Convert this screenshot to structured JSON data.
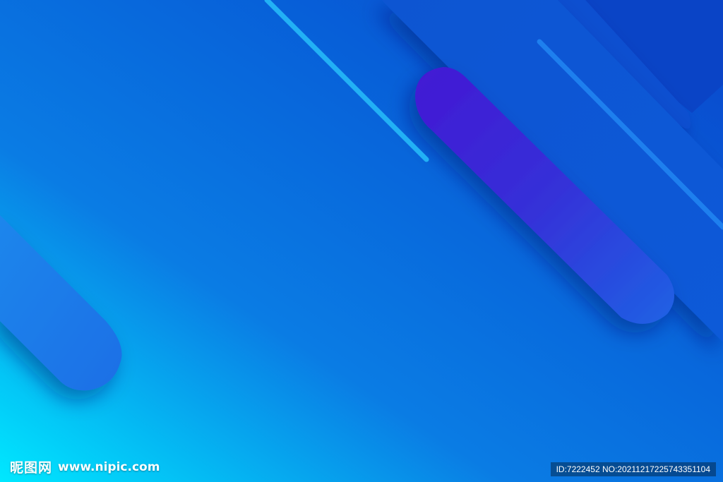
{
  "watermark": {
    "site_name_cn": "昵图网",
    "site_url": "www.nipic.com",
    "id_text": "ID:7222452 NO:20211217225743351104"
  },
  "colors": {
    "background_start": "#00e5ff",
    "background_mid": "#0a6fe0",
    "background_end": "#0040c8",
    "accent_line": "#29b6f6",
    "purple_pill": "#4a1fd6"
  }
}
